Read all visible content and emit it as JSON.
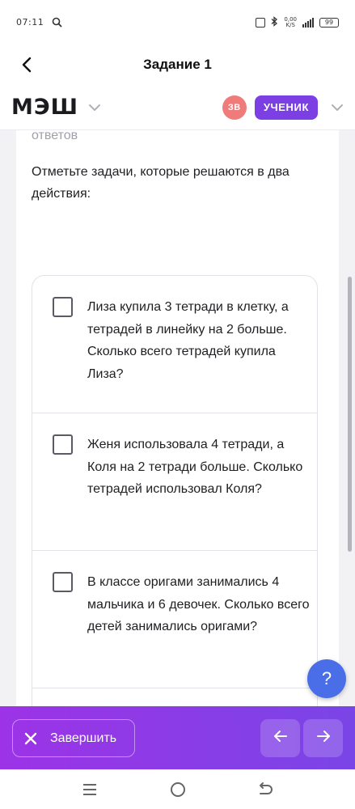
{
  "status_bar": {
    "time": "07:11",
    "speed_value": "0,00",
    "speed_unit": "K/S",
    "battery": "99",
    "icons": [
      "search-icon",
      "nfc-icon",
      "bluetooth-icon",
      "signal-icon",
      "battery-icon"
    ]
  },
  "title_bar": {
    "title": "Задание 1"
  },
  "header": {
    "logo": "МЭШ",
    "avatar_initials": "ЗВ",
    "role_label": "УЧЕНИК",
    "colors": {
      "avatar": "#f07b7b",
      "role_badge": "#7b3fe4"
    }
  },
  "content": {
    "prev_text": "ответов",
    "question": "Отметьте задачи, которые решаются в два действия:",
    "options": [
      {
        "text": "Лиза купила 3 тетради в клетку, а тетрадей в линейку на 2 больше. Сколько всего тетрадей купила Лиза?",
        "checked": false
      },
      {
        "text": "Женя использовала 4 тетради, а Коля на 2 тетради больше. Сколько тетрадей использовал Коля?",
        "checked": false
      },
      {
        "text": "В классе оригами занимались 4 мальчика и 6 девочек. Сколько всего детей занимались оригами?",
        "checked": false
      }
    ]
  },
  "help_button": {
    "label": "?"
  },
  "bottom_bar": {
    "finish_label": "Завершить",
    "colors": {
      "gradient_start": "#9c33e6",
      "gradient_end": "#7a45e6"
    }
  }
}
